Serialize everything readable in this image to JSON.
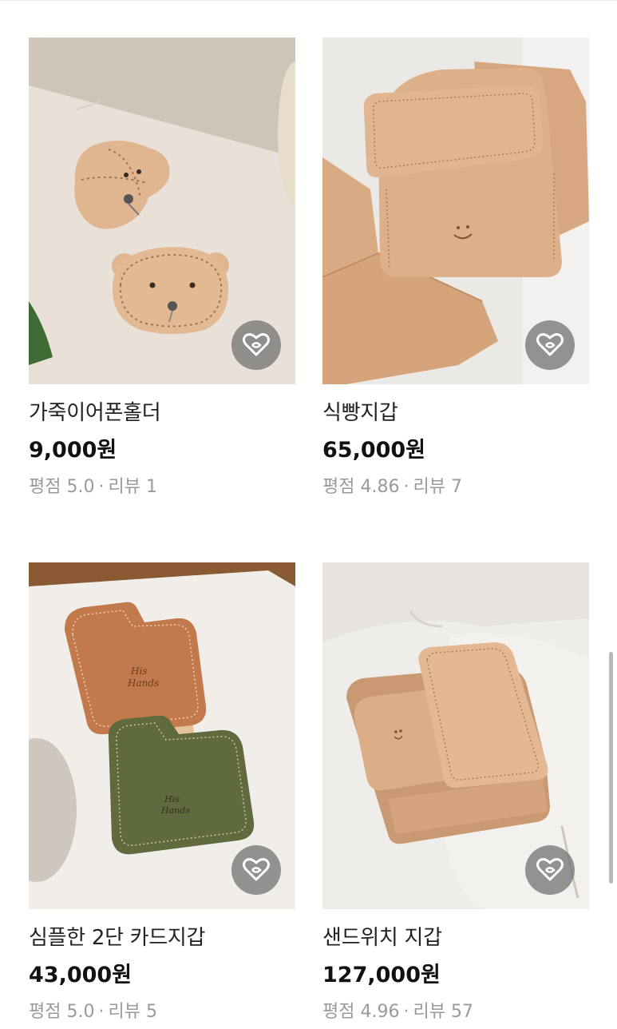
{
  "products": [
    {
      "name": "가죽이어폰홀더",
      "price": "9,000원",
      "rating_label": "평점",
      "rating": "5.0",
      "review_label": "리뷰",
      "reviews": "1",
      "image_icon": "bear-earphone-holder-photo",
      "wish_icon": "heart-icon"
    },
    {
      "name": "식빵지갑",
      "price": "65,000원",
      "rating_label": "평점",
      "rating": "4.86",
      "review_label": "리뷰",
      "reviews": "7",
      "image_icon": "bread-wallet-photo",
      "wish_icon": "heart-icon"
    },
    {
      "name": "심플한 2단 카드지갑",
      "price": "43,000원",
      "rating_label": "평점",
      "rating": "5.0",
      "review_label": "리뷰",
      "reviews": "5",
      "image_icon": "card-wallet-photo",
      "wish_icon": "heart-icon"
    },
    {
      "name": "샌드위치 지갑",
      "price": "127,000원",
      "rating_label": "평점",
      "rating": "4.96",
      "review_label": "리뷰",
      "reviews": "57",
      "image_icon": "sandwich-wallet-photo",
      "wish_icon": "heart-icon"
    }
  ],
  "separator": "·",
  "colors": {
    "leather": "#e0b690",
    "wish_button": "#6e6e6e",
    "meta_text": "#9a9a9a"
  }
}
